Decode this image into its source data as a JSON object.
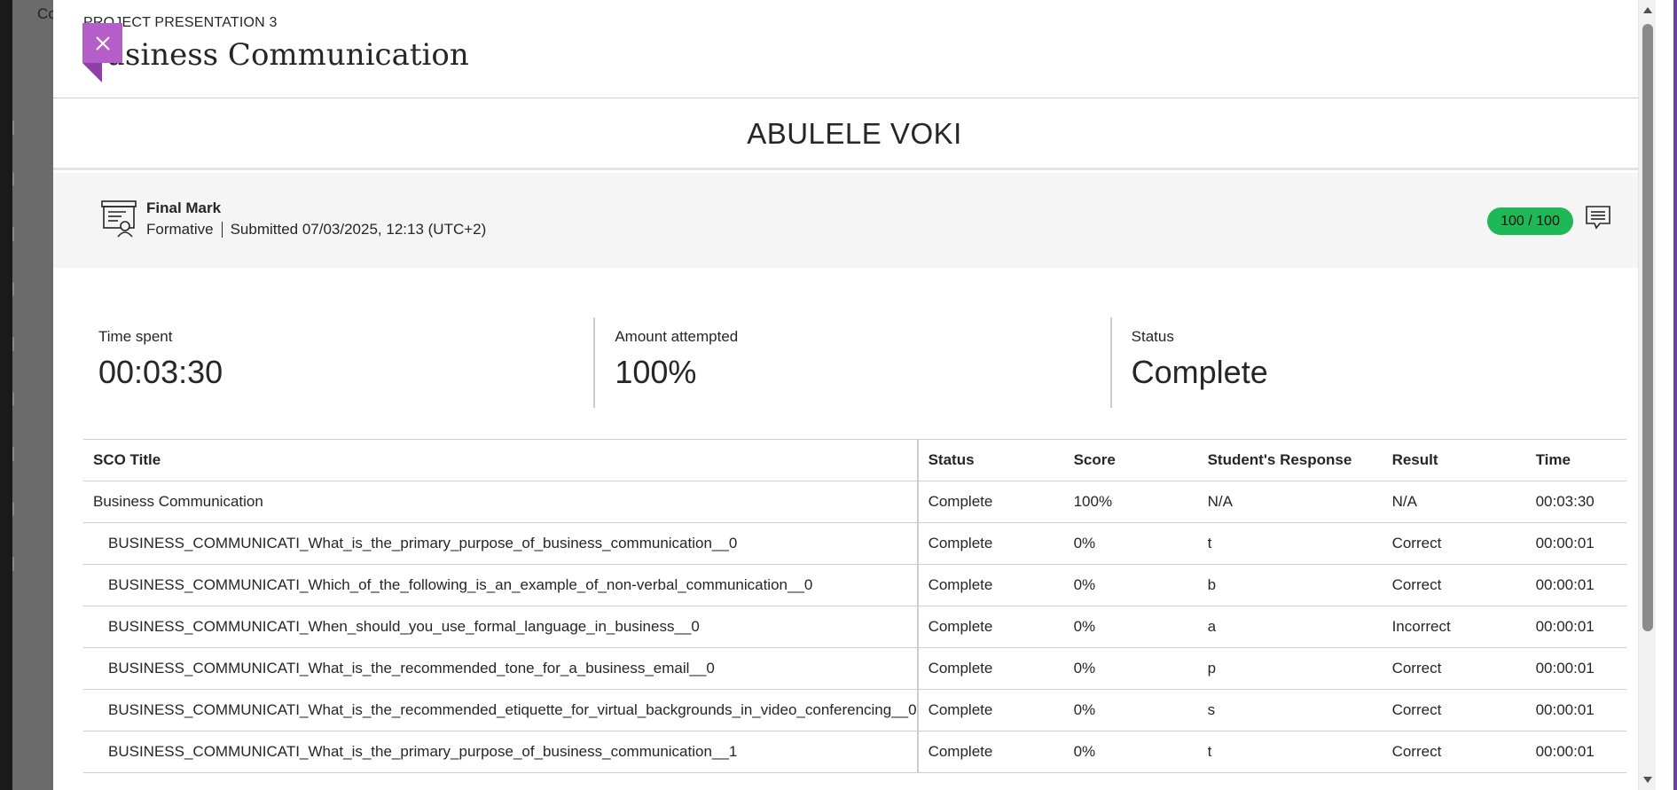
{
  "background": {
    "app_title_fragment": "Co"
  },
  "panel": {
    "subtitle": "PROJECT PRESENTATION 3",
    "title": "Business Communication",
    "close_icon": "close-icon"
  },
  "student": {
    "name": "ABULELE VOKI"
  },
  "final_mark": {
    "icon": "certificate-icon",
    "label": "Final Mark",
    "type": "Formative",
    "submitted": "Submitted 07/03/2025, 12:13 (UTC+2)",
    "grade": "100 / 100",
    "feedback_icon": "feedback-comment-icon",
    "grade_color": "#1eb856"
  },
  "stats": [
    {
      "label": "Time spent",
      "value": "00:03:30"
    },
    {
      "label": "Amount attempted",
      "value": "100%"
    },
    {
      "label": "Status",
      "value": "Complete"
    }
  ],
  "table": {
    "headers": [
      "SCO Title",
      "Status",
      "Score",
      "Student's Response",
      "Result",
      "Time"
    ],
    "rows": [
      {
        "title": "Business Communication",
        "status": "Complete",
        "score": "100%",
        "response": "N/A",
        "result": "N/A",
        "time": "00:03:30"
      },
      {
        "title": "BUSINESS_COMMUNICATI_What_is_the_primary_purpose_of_business_communication__0",
        "status": "Complete",
        "score": "0%",
        "response": "t",
        "result": "Correct",
        "time": "00:00:01"
      },
      {
        "title": "BUSINESS_COMMUNICATI_Which_of_the_following_is_an_example_of_non-verbal_communication__0",
        "status": "Complete",
        "score": "0%",
        "response": "b",
        "result": "Correct",
        "time": "00:00:01"
      },
      {
        "title": "BUSINESS_COMMUNICATI_When_should_you_use_formal_language_in_business__0",
        "status": "Complete",
        "score": "0%",
        "response": "a",
        "result": "Incorrect",
        "time": "00:00:01"
      },
      {
        "title": "BUSINESS_COMMUNICATI_What_is_the_recommended_tone_for_a_business_email__0",
        "status": "Complete",
        "score": "0%",
        "response": "p",
        "result": "Correct",
        "time": "00:00:01"
      },
      {
        "title": "BUSINESS_COMMUNICATI_What_is_the_recommended_etiquette_for_virtual_backgrounds_in_video_conferencing__0",
        "status": "Complete",
        "score": "0%",
        "response": "s",
        "result": "Correct",
        "time": "00:00:01"
      },
      {
        "title": "BUSINESS_COMMUNICATI_What_is_the_primary_purpose_of_business_communication__1",
        "status": "Complete",
        "score": "0%",
        "response": "t",
        "result": "Correct",
        "time": "00:00:01"
      }
    ]
  },
  "colors": {
    "accent": "#b55dc8",
    "accent_dark": "#8e3fa3",
    "success": "#1eb856"
  }
}
